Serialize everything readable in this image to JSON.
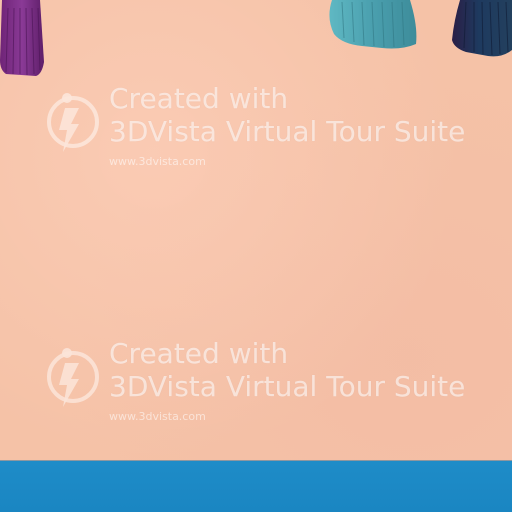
{
  "watermarks": [
    {
      "line1": "Created with",
      "line2": "3DVista Virtual Tour Suite",
      "url": "www.3dvista.com"
    },
    {
      "line1": "Created with",
      "line2": "3DVista Virtual Tour Suite",
      "url": "www.3dvista.com"
    }
  ],
  "colors": {
    "wall": "#F5C2A7",
    "floor": "#1E8CC8",
    "tassel_purple": "#7A2F86",
    "tassel_teal": "#4FA7B5",
    "tassel_navy": "#1D2E57"
  },
  "icons": {
    "watermark_logo": "3dvista-logo-icon"
  }
}
